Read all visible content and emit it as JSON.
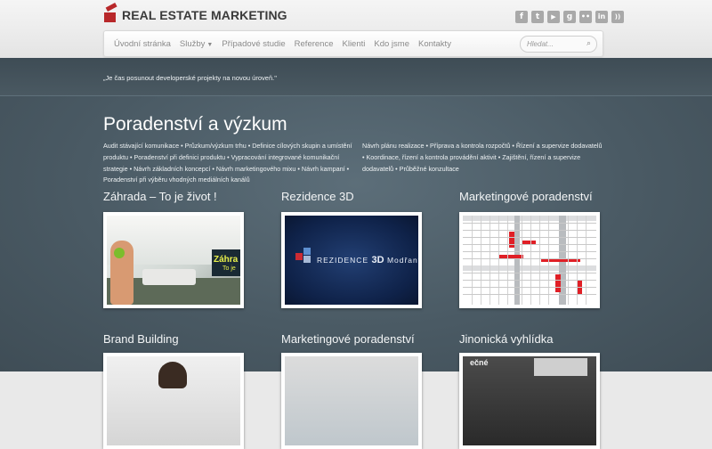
{
  "brand": {
    "name": "REAL ESTATE MARKETING"
  },
  "social": [
    {
      "icon": "facebook-icon",
      "glyph": "f"
    },
    {
      "icon": "twitter-icon",
      "glyph": "t"
    },
    {
      "icon": "youtube-icon",
      "glyph": "▶"
    },
    {
      "icon": "google-icon",
      "glyph": "g"
    },
    {
      "icon": "flickr-icon",
      "glyph": "••"
    },
    {
      "icon": "linkedin-icon",
      "glyph": "in"
    },
    {
      "icon": "rss-icon",
      "glyph": "))"
    }
  ],
  "nav": {
    "items": [
      "Úvodní stránka",
      "Služby",
      "Případové studie",
      "Reference",
      "Klienti",
      "Kdo jsme",
      "Kontakty"
    ],
    "dropdown_caret": "▼",
    "search_placeholder": "Hledat..."
  },
  "quote": "„Je čas posunout developerské projekty na novou úroveň.\"",
  "section": {
    "title": "Poradenství a výzkum",
    "left_text": "Audit stávající komunikace • Průzkum/výzkum trhu • Definice cílových skupin a umístění produktu • Poradenství při definici produktu • Vypracování integrované komunikační strategie • Návrh základních koncepcí • Návrh marketingového mixu • Návrh kampaní • Poradenství při výběru vhodných mediálních kanálů",
    "right_text": "Návrh plánu realizace • Příprava a kontrola rozpočtů • Řízení a supervize dodavatelů • Koordinace, řízení a kontrola provádění aktivit • Zajištění, řízení a supervize dodavatelů • Průběžné konzultace"
  },
  "cards": [
    {
      "title": "Záhrada – To je život !",
      "thumb_text_1": "Záhra",
      "thumb_text_2": "To je"
    },
    {
      "title": "Rezidence 3D",
      "thumb_text_1": "REZIDENCE",
      "thumb_text_2": "3D",
      "thumb_text_3": "Modřany"
    },
    {
      "title": "Marketingové poradenství"
    },
    {
      "title": "Brand Building"
    },
    {
      "title": "Marketingové poradenství"
    },
    {
      "title": "Jinonická vyhlídka",
      "thumb_text_1": "ečné"
    }
  ],
  "colors": {
    "brand_red": "#b8282a",
    "content_bg": "#4a5a64",
    "gantt_red": "#e01f26"
  }
}
